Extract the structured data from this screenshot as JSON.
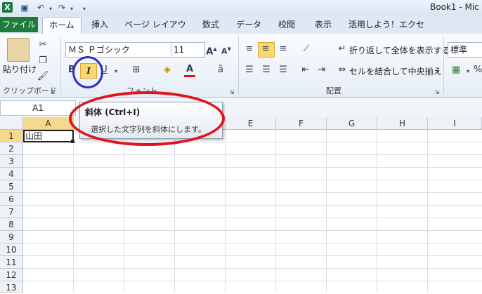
{
  "title_bar": {
    "title": "Book1 - Mic",
    "logo": "X"
  },
  "qat": {
    "save_icon": "save-icon",
    "undo_icon": "undo-icon",
    "redo_icon": "redo-icon"
  },
  "tabs": [
    "ファイル",
    "ホーム",
    "挿入",
    "ページ レイアウト",
    "数式",
    "データ",
    "校閲",
    "表示",
    "活用しよう！エクセル"
  ],
  "clipboard": {
    "paste_label": "貼り付け",
    "group_label": "クリップボード"
  },
  "font": {
    "name": "ＭＳ Ｐゴシック",
    "size": "11",
    "group_label": "フォント",
    "bold": "B",
    "italic": "I",
    "underline": "U",
    "font_color_glyph": "A"
  },
  "alignment": {
    "wrap_text": "折り返して全体を表示する",
    "merge_center": "セルを結合して中央揃え",
    "group_label": "配置"
  },
  "number": {
    "format": "標準",
    "percent": "%"
  },
  "name_box": "A1",
  "columns": [
    "A",
    "B",
    "C",
    "D",
    "E",
    "F",
    "G",
    "H",
    "I"
  ],
  "rows": [
    "1",
    "2",
    "3",
    "4",
    "5",
    "6",
    "7",
    "8",
    "9",
    "10",
    "11",
    "12",
    "13"
  ],
  "cell_a1": "山田",
  "tooltip": {
    "title": "斜体 (Ctrl+I)",
    "description": "選択した文字列を斜体にします。"
  },
  "colors": {
    "file_tab": "#1e7a3d",
    "highlight": "#fbd773",
    "red_annotation": "#e0141e",
    "blue_annotation": "#2e2db8"
  }
}
